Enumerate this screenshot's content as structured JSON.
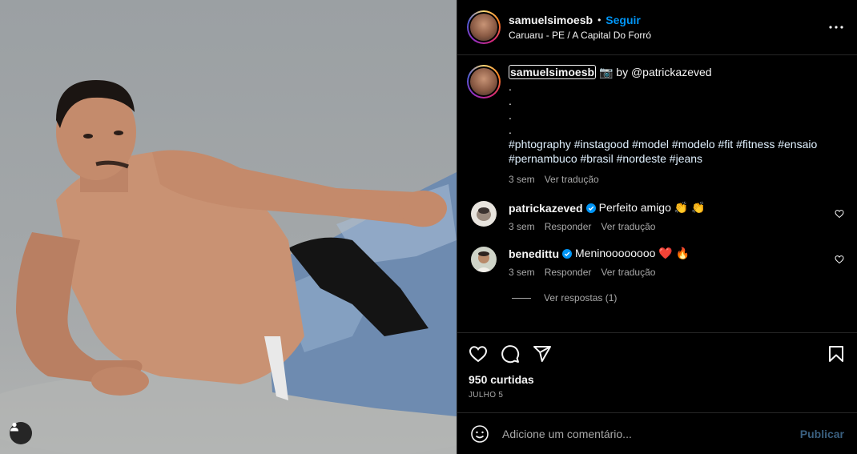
{
  "post": {
    "image_alt": "",
    "author": {
      "username": "samuelsimoesb",
      "follow_label": "Seguir",
      "location": "Caruaru - PE / A Capital Do Forró"
    },
    "caption": {
      "username": "samuelsimoesb",
      "camera_emoji": "📷",
      "credit": "by @patrickazeved",
      "dots": [
        ".",
        ".",
        ".",
        "."
      ],
      "hashtags": "#phtography #instagood #model #modelo #fit #fitness #ensaio #pernambuco #brasil #nordeste #jeans",
      "time": "3 sem",
      "translate": "Ver tradução"
    },
    "comments": [
      {
        "username": "patrickazeved",
        "verified": true,
        "text": "Perfeito amigo 👏 👏",
        "time": "3 sem",
        "reply": "Responder",
        "translate": "Ver tradução"
      },
      {
        "username": "benedittu",
        "verified": true,
        "text": "Meninoooooooo ❤️ 🔥",
        "time": "3 sem",
        "reply": "Responder",
        "translate": "Ver tradução"
      }
    ],
    "view_replies": "Ver respostas (1)",
    "likes": "950 curtidas",
    "date": "JULHO 5",
    "add_comment": {
      "placeholder": "Adicione um comentário...",
      "publish_label": "Publicar"
    }
  },
  "colors": {
    "background": "#000000",
    "accent": "#0095f6",
    "muted": "#a8a8a8",
    "divider": "#262626"
  }
}
